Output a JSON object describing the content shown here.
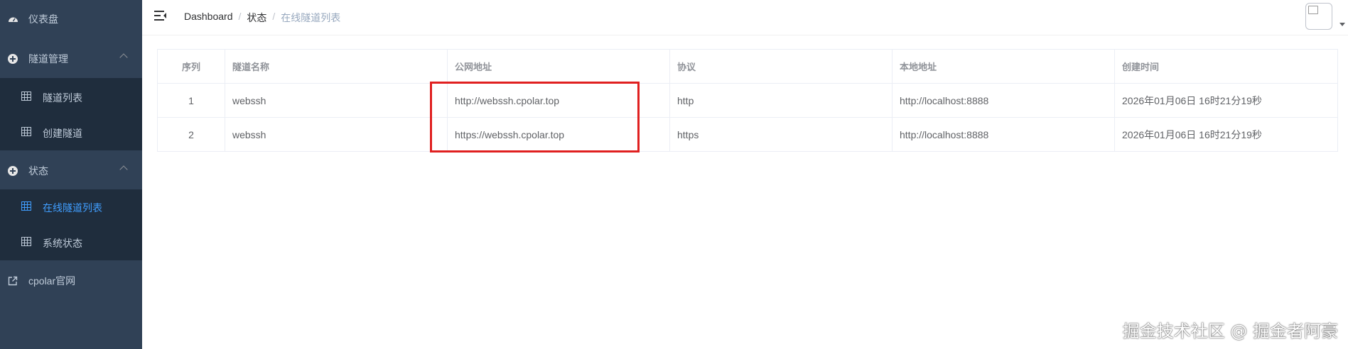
{
  "sidebar": {
    "dashboard": "仪表盘",
    "tunnel_mgmt": "隧道管理",
    "tunnel_list": "隧道列表",
    "create_tunnel": "创建隧道",
    "status": "状态",
    "online_tunnels": "在线隧道列表",
    "system_status": "系统状态",
    "official_site": "cpolar官网"
  },
  "breadcrumb": {
    "home": "Dashboard",
    "sep": "/",
    "level2": "状态",
    "current": "在线隧道列表"
  },
  "table": {
    "headers": [
      "序列",
      "隧道名称",
      "公网地址",
      "协议",
      "本地地址",
      "创建时间"
    ],
    "rows": [
      [
        "1",
        "webssh",
        "http://webssh.cpolar.top",
        "http",
        "http://localhost:8888",
        "2026年01月06日 16时21分19秒"
      ],
      [
        "2",
        "webssh",
        "https://webssh.cpolar.top",
        "https",
        "http://localhost:8888",
        "2026年01月06日 16时21分19秒"
      ]
    ]
  },
  "watermark": "掘金技术社区 @ 掘金者阿豪",
  "colors": {
    "sidebar_bg": "#304156",
    "submenu_bg": "#1f2d3d",
    "active": "#409eff",
    "highlight": "#e02020"
  }
}
